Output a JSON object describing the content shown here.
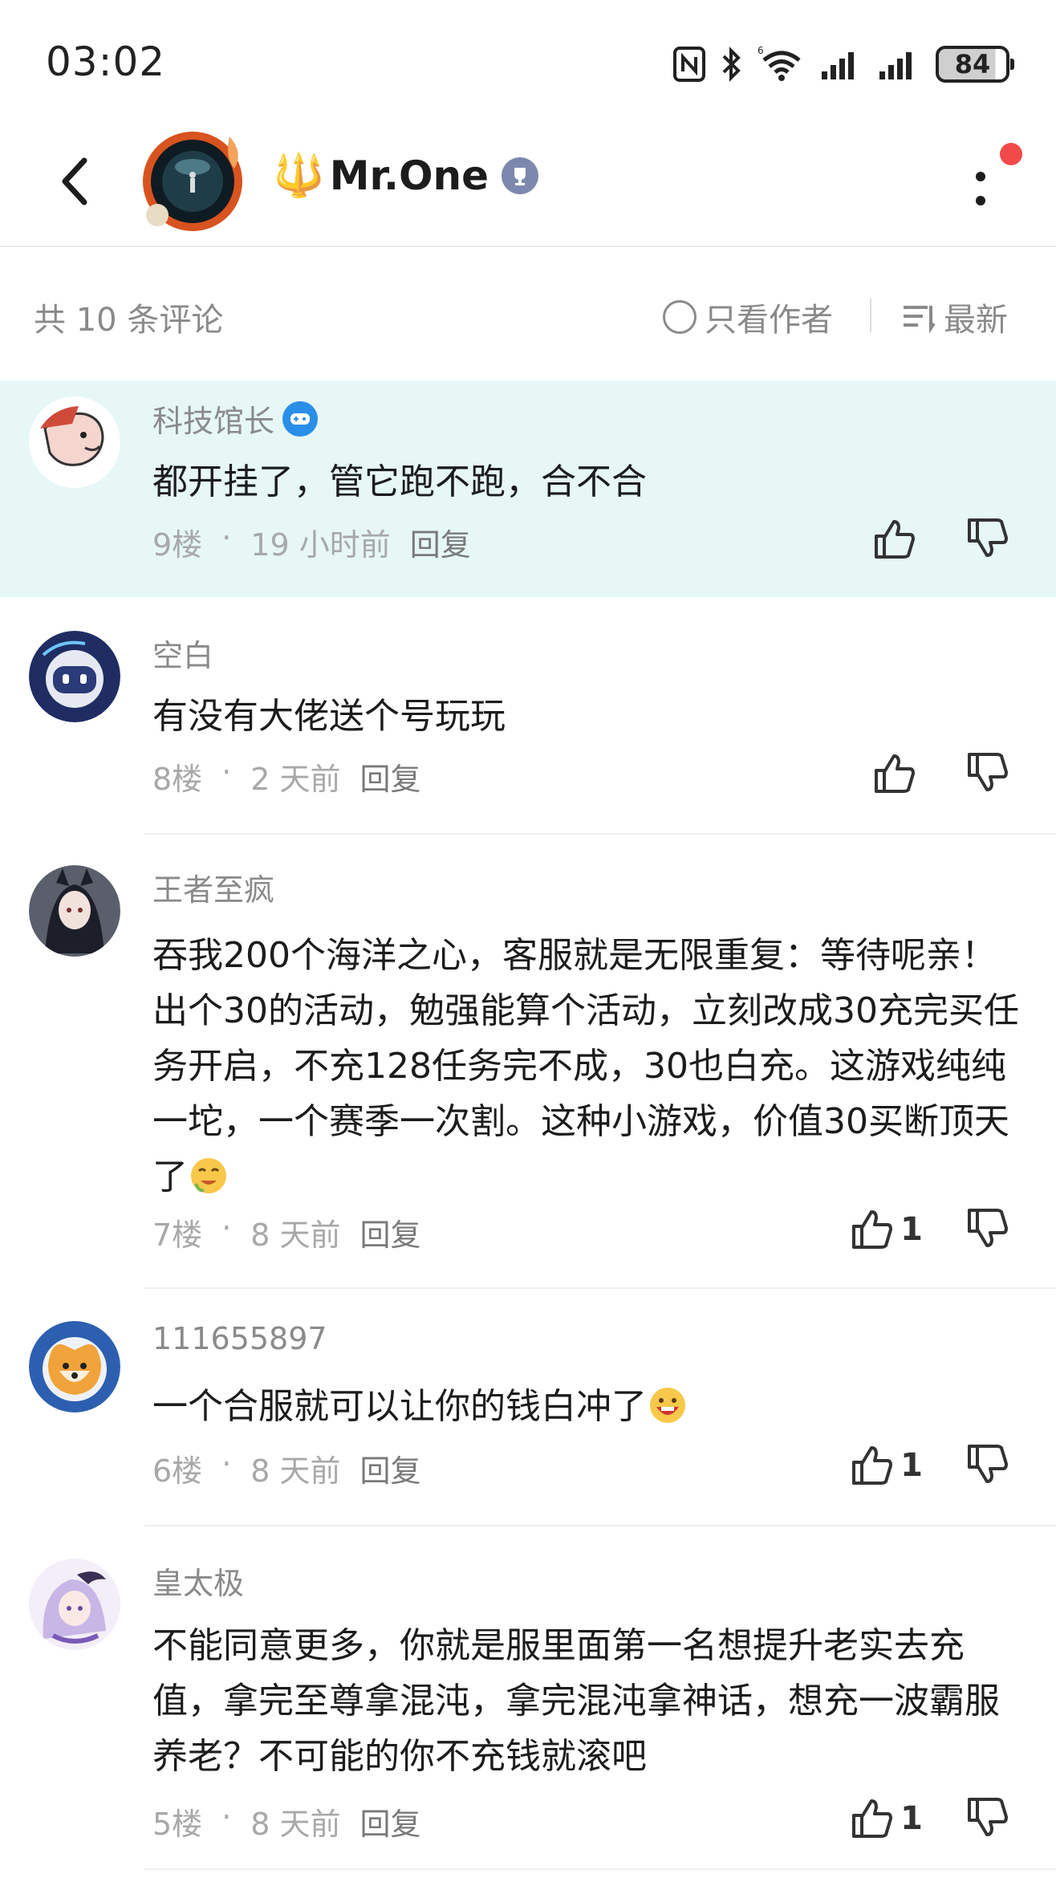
{
  "status_bar": {
    "time": "03:02",
    "battery_level": "84"
  },
  "header": {
    "title": "Mr.One",
    "trident_glyph": "🔱"
  },
  "filter": {
    "count_label": "共 10 条评论",
    "author_only_label": "只看作者",
    "sort_label": "最新"
  },
  "comments": [
    {
      "author": "科技馆长",
      "text": "都开挂了，管它跑不跑，合不合",
      "floor": "9楼",
      "time": "19 小时前",
      "reply": "回复",
      "likes": ""
    },
    {
      "author": "空白",
      "text": "有没有大佬送个号玩玩",
      "floor": "8楼",
      "time": "2 天前",
      "reply": "回复",
      "likes": ""
    },
    {
      "author": "王者至疯",
      "text": "吞我200个海洋之心，客服就是无限重复：等待呢亲！出个30的活动，勉强能算个活动，立刻改成30充完买任务开启，不充128任务完不成，30也白充。这游戏纯纯一坨，一个赛季一次割。这种小游戏，价值30买断顶天了",
      "floor": "7楼",
      "time": "8 天前",
      "reply": "回复",
      "likes": "1"
    },
    {
      "author": "111655897",
      "text": "一个合服就可以让你的钱白冲了",
      "floor": "6楼",
      "time": "8 天前",
      "reply": "回复",
      "likes": "1"
    },
    {
      "author": "皇太极",
      "text": "不能同意更多，你就是服里面第一名想提升老实去充值，拿完至尊拿混沌，拿完混沌拿神话，想充一波霸服养老？不可能的你不充钱就滚吧",
      "floor": "5楼",
      "time": "8 天前",
      "reply": "回复",
      "likes": "1"
    }
  ],
  "icons": {
    "back": "chevron-left-icon",
    "more": "more-vertical-icon",
    "like": "thumbs-up-icon",
    "dislike": "thumbs-down-icon",
    "sort": "sort-lines-icon",
    "trophy": "trophy-icon"
  },
  "colors": {
    "highlight_bg": "#e6f7f6",
    "notification_dot": "#f24a4a",
    "badge_blue": "#2a8fe8"
  }
}
